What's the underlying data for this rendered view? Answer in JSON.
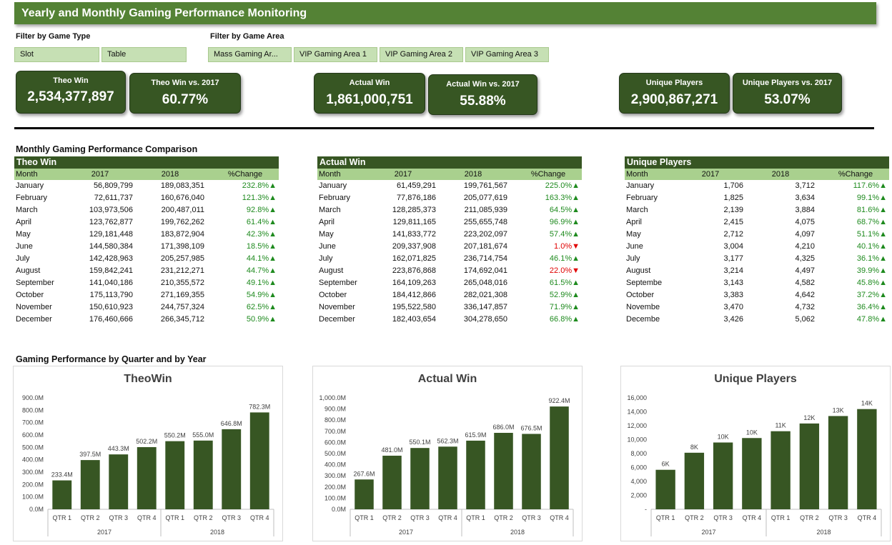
{
  "header": {
    "title": "Yearly and Monthly Gaming Performance Monitoring"
  },
  "filters": {
    "game_type": {
      "label": "Filter by Game Type",
      "options": [
        "Slot",
        "Table"
      ]
    },
    "game_area": {
      "label": "Filter by Game Area",
      "options": [
        "Mass Gaming Ar...",
        "VIP Gaming Area 1",
        "VIP Gaming Area 2",
        "VIP Gaming Area 3"
      ]
    }
  },
  "kpis": [
    {
      "title": "Theo Win",
      "value": "2,534,377,897"
    },
    {
      "title": "Theo Win vs. 2017",
      "value": "60.77%"
    },
    {
      "title": "Actual Win",
      "value": "1,861,000,751"
    },
    {
      "title": "Actual Win vs. 2017",
      "value": "55.88%"
    },
    {
      "title": "Unique Players",
      "value": "2,900,867,271"
    },
    {
      "title": "Unique Players vs. 2017",
      "value": "53.07%"
    }
  ],
  "colors": {
    "banner": "#548235",
    "kpi": "#375623",
    "table_title": "#375623",
    "table_header": "#a9d08e",
    "slicer": "#c6e0b4",
    "bar": "#375623",
    "up": "#1e8a1e",
    "down": "#e00000"
  },
  "monthly_section_title": "Monthly Gaming Performance Comparison",
  "tables": [
    {
      "title": "Theo Win",
      "columns": [
        "Month",
        "2017",
        "2018",
        "%Change"
      ],
      "rows": [
        {
          "month": "January",
          "y2017": "56,809,799",
          "y2018": "189,083,351",
          "change": "232.8%",
          "dir": "up"
        },
        {
          "month": "February",
          "y2017": "72,611,737",
          "y2018": "160,676,040",
          "change": "121.3%",
          "dir": "up"
        },
        {
          "month": "March",
          "y2017": "103,973,506",
          "y2018": "200,487,011",
          "change": "92.8%",
          "dir": "up"
        },
        {
          "month": "April",
          "y2017": "123,762,877",
          "y2018": "199,762,262",
          "change": "61.4%",
          "dir": "up"
        },
        {
          "month": "May",
          "y2017": "129,181,448",
          "y2018": "183,872,904",
          "change": "42.3%",
          "dir": "up"
        },
        {
          "month": "June",
          "y2017": "144,580,384",
          "y2018": "171,398,109",
          "change": "18.5%",
          "dir": "up"
        },
        {
          "month": "July",
          "y2017": "142,428,963",
          "y2018": "205,257,985",
          "change": "44.1%",
          "dir": "up"
        },
        {
          "month": "August",
          "y2017": "159,842,241",
          "y2018": "231,212,271",
          "change": "44.7%",
          "dir": "up"
        },
        {
          "month": "September",
          "y2017": "141,040,186",
          "y2018": "210,355,572",
          "change": "49.1%",
          "dir": "up"
        },
        {
          "month": "October",
          "y2017": "175,113,790",
          "y2018": "271,169,355",
          "change": "54.9%",
          "dir": "up"
        },
        {
          "month": "November",
          "y2017": "150,610,923",
          "y2018": "244,757,324",
          "change": "62.5%",
          "dir": "up"
        },
        {
          "month": "December",
          "y2017": "176,460,666",
          "y2018": "266,345,712",
          "change": "50.9%",
          "dir": "up"
        }
      ]
    },
    {
      "title": "Actual Win",
      "columns": [
        "Month",
        "2017",
        "2018",
        "%Change"
      ],
      "rows": [
        {
          "month": "January",
          "y2017": "61,459,291",
          "y2018": "199,761,567",
          "change": "225.0%",
          "dir": "up"
        },
        {
          "month": "February",
          "y2017": "77,876,186",
          "y2018": "205,077,619",
          "change": "163.3%",
          "dir": "up"
        },
        {
          "month": "March",
          "y2017": "128,285,373",
          "y2018": "211,085,939",
          "change": "64.5%",
          "dir": "up"
        },
        {
          "month": "April",
          "y2017": "129,811,165",
          "y2018": "255,655,748",
          "change": "96.9%",
          "dir": "up"
        },
        {
          "month": "May",
          "y2017": "141,833,772",
          "y2018": "223,202,097",
          "change": "57.4%",
          "dir": "up"
        },
        {
          "month": "June",
          "y2017": "209,337,908",
          "y2018": "207,181,674",
          "change": "1.0%",
          "dir": "down"
        },
        {
          "month": "July",
          "y2017": "162,071,825",
          "y2018": "236,714,754",
          "change": "46.1%",
          "dir": "up"
        },
        {
          "month": "August",
          "y2017": "223,876,868",
          "y2018": "174,692,041",
          "change": "22.0%",
          "dir": "down"
        },
        {
          "month": "September",
          "y2017": "164,109,263",
          "y2018": "265,048,016",
          "change": "61.5%",
          "dir": "up"
        },
        {
          "month": "October",
          "y2017": "184,412,866",
          "y2018": "282,021,308",
          "change": "52.9%",
          "dir": "up"
        },
        {
          "month": "November",
          "y2017": "195,522,580",
          "y2018": "336,147,857",
          "change": "71.9%",
          "dir": "up"
        },
        {
          "month": "December",
          "y2017": "182,403,654",
          "y2018": "304,278,650",
          "change": "66.8%",
          "dir": "up"
        }
      ]
    },
    {
      "title": "Unique Players",
      "columns": [
        "Month",
        "2017",
        "2018",
        "%Change"
      ],
      "rows": [
        {
          "month": "January",
          "y2017": "1,706",
          "y2018": "3,712",
          "change": "117.6%",
          "dir": "up"
        },
        {
          "month": "February",
          "y2017": "1,825",
          "y2018": "3,634",
          "change": "99.1%",
          "dir": "up"
        },
        {
          "month": "March",
          "y2017": "2,139",
          "y2018": "3,884",
          "change": "81.6%",
          "dir": "up"
        },
        {
          "month": "April",
          "y2017": "2,415",
          "y2018": "4,075",
          "change": "68.7%",
          "dir": "up"
        },
        {
          "month": "May",
          "y2017": "2,712",
          "y2018": "4,097",
          "change": "51.1%",
          "dir": "up"
        },
        {
          "month": "June",
          "y2017": "3,004",
          "y2018": "4,210",
          "change": "40.1%",
          "dir": "up"
        },
        {
          "month": "July",
          "y2017": "3,177",
          "y2018": "4,325",
          "change": "36.1%",
          "dir": "up"
        },
        {
          "month": "August",
          "y2017": "3,214",
          "y2018": "4,497",
          "change": "39.9%",
          "dir": "up"
        },
        {
          "month": "Septembe",
          "y2017": "3,143",
          "y2018": "4,582",
          "change": "45.8%",
          "dir": "up"
        },
        {
          "month": "October",
          "y2017": "3,383",
          "y2018": "4,642",
          "change": "37.2%",
          "dir": "up"
        },
        {
          "month": "Novembe",
          "y2017": "3,470",
          "y2018": "4,732",
          "change": "36.4%",
          "dir": "up"
        },
        {
          "month": "Decembe",
          "y2017": "3,426",
          "y2018": "5,062",
          "change": "47.8%",
          "dir": "up"
        }
      ]
    }
  ],
  "quarter_section_title": "Gaming Performance by Quarter and by Year",
  "chart_data": [
    {
      "type": "bar",
      "title": "TheoWin",
      "categories": [
        "QTR 1",
        "QTR 2",
        "QTR 3",
        "QTR 4",
        "QTR 1",
        "QTR 2",
        "QTR 3",
        "QTR 4"
      ],
      "groups": [
        "2017",
        "2018"
      ],
      "values": [
        233.4,
        397.5,
        443.3,
        502.2,
        550.2,
        555.0,
        646.8,
        782.3
      ],
      "data_labels": [
        "233.4M",
        "397.5M",
        "443.3M",
        "502.2M",
        "550.2M",
        "555.0M",
        "646.8M",
        "782.3M"
      ],
      "ylim": [
        0,
        900
      ],
      "yticks": [
        0,
        100,
        200,
        300,
        400,
        500,
        600,
        700,
        800,
        900
      ],
      "ytick_labels": [
        "0.0M",
        "100.0M",
        "200.0M",
        "300.0M",
        "400.0M",
        "500.0M",
        "600.0M",
        "700.0M",
        "800.0M",
        "900.0M"
      ],
      "grid": false,
      "color": "#375623"
    },
    {
      "type": "bar",
      "title": "Actual Win",
      "categories": [
        "QTR 1",
        "QTR 2",
        "QTR 3",
        "QTR 4",
        "QTR 1",
        "QTR 2",
        "QTR 3",
        "QTR 4"
      ],
      "groups": [
        "2017",
        "2018"
      ],
      "values": [
        267.6,
        481.0,
        550.1,
        562.3,
        615.9,
        686.0,
        676.5,
        922.4
      ],
      "data_labels": [
        "267.6M",
        "481.0M",
        "550.1M",
        "562.3M",
        "615.9M",
        "686.0M",
        "676.5M",
        "922.4M"
      ],
      "ylim": [
        0,
        1000
      ],
      "yticks": [
        0,
        100,
        200,
        300,
        400,
        500,
        600,
        700,
        800,
        900,
        1000
      ],
      "ytick_labels": [
        "0.0M",
        "100.0M",
        "200.0M",
        "300.0M",
        "400.0M",
        "500.0M",
        "600.0M",
        "700.0M",
        "800.0M",
        "900.0M",
        "1,000.0M"
      ],
      "grid": false,
      "color": "#375623"
    },
    {
      "type": "bar",
      "title": "Unique Players",
      "categories": [
        "QTR 1",
        "QTR 2",
        "QTR 3",
        "QTR 4",
        "QTR 1",
        "QTR 2",
        "QTR 3",
        "QTR 4"
      ],
      "groups": [
        "2017",
        "2018"
      ],
      "values": [
        5670,
        8120,
        9590,
        10230,
        11210,
        12320,
        13390,
        14390
      ],
      "data_labels": [
        "6K",
        "8K",
        "10K",
        "10K",
        "11K",
        "12K",
        "13K",
        "14K"
      ],
      "ylim": [
        0,
        16000
      ],
      "yticks": [
        0,
        2000,
        4000,
        6000,
        8000,
        10000,
        12000,
        14000,
        16000
      ],
      "ytick_labels": [
        "-",
        "2,000",
        "4,000",
        "6,000",
        "8,000",
        "10,000",
        "12,000",
        "14,000",
        "16,000"
      ],
      "grid": false,
      "color": "#375623"
    }
  ]
}
